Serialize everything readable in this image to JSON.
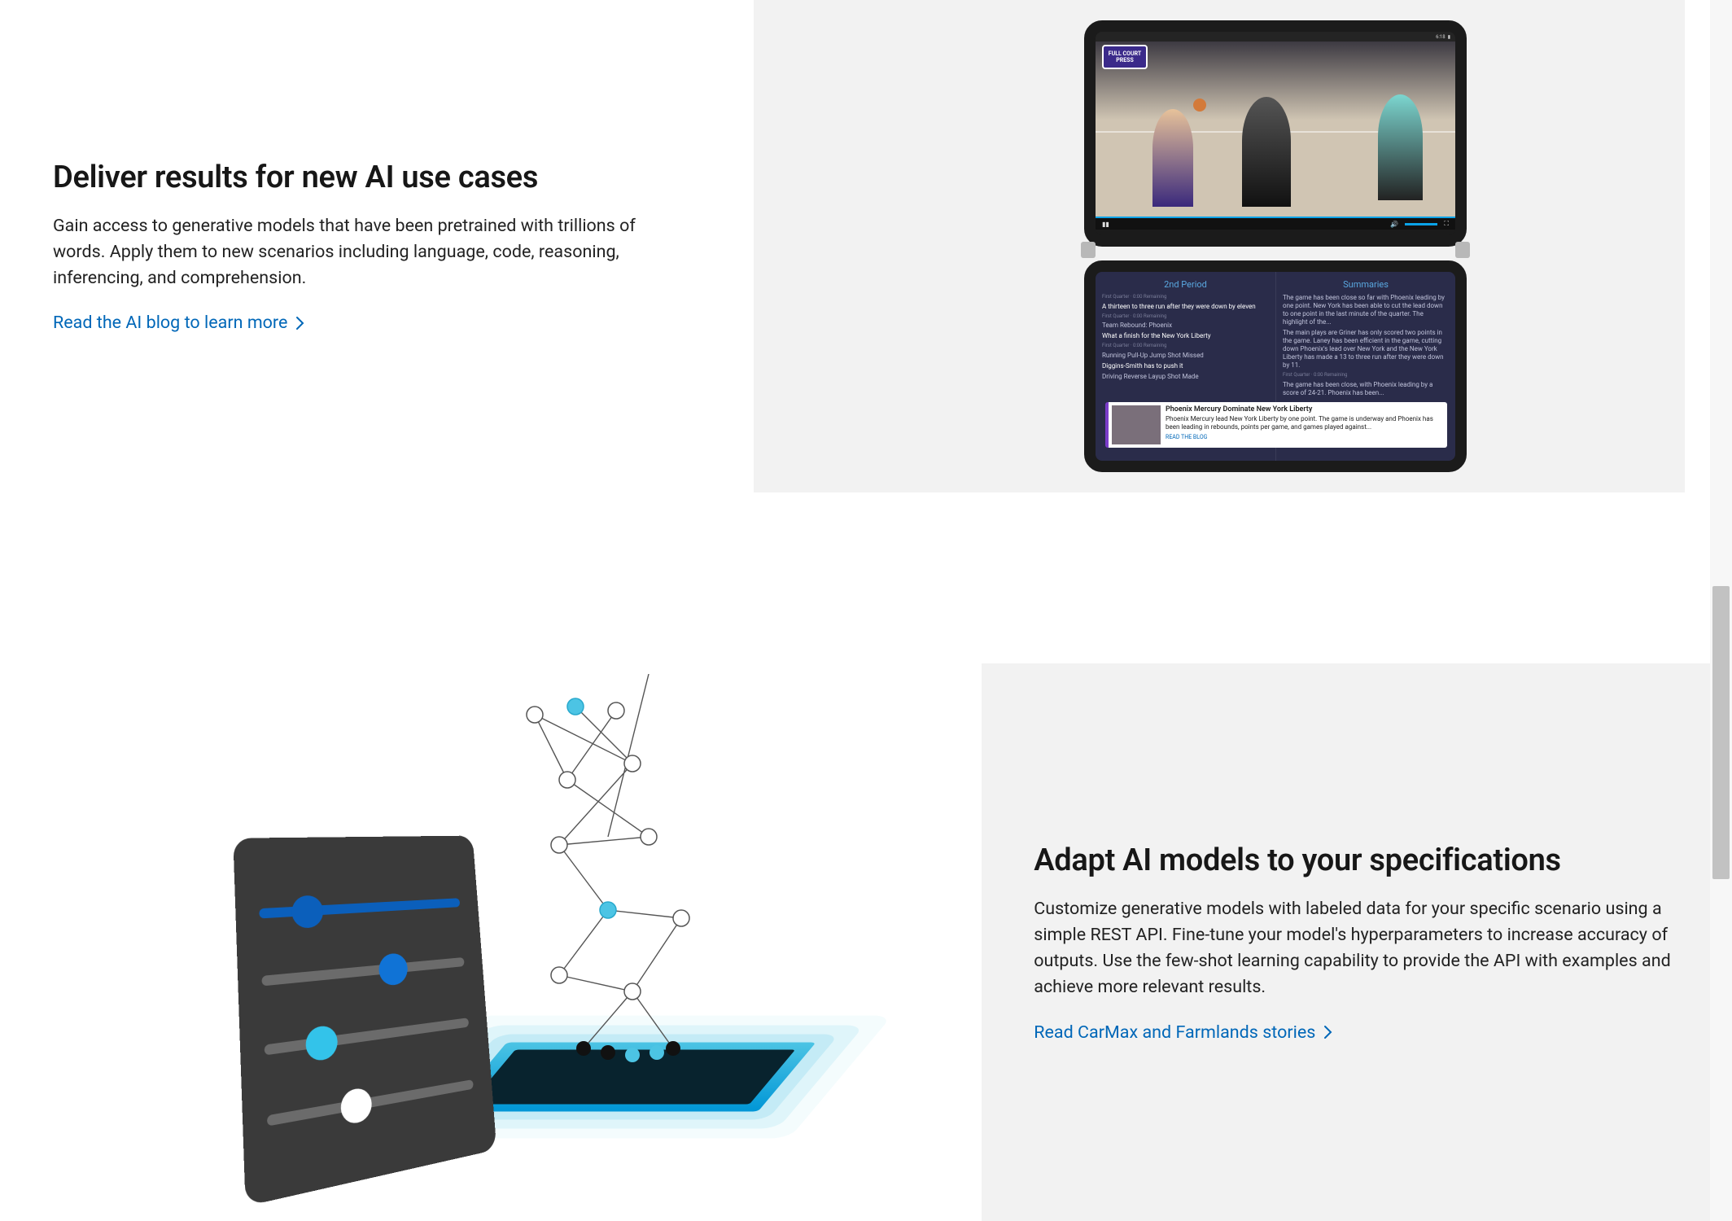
{
  "section1": {
    "heading": "Deliver results for new AI use cases",
    "body": "Gain access to generative models that have been pretrained with trillions of words. Apply them to new scenarios including language, code, reasoning, inferencing, and comprehension.",
    "link_label": "Read the AI blog to learn more"
  },
  "section2": {
    "heading": "Adapt AI models to your specifications",
    "body": "Customize generative models with labeled data for your specific scenario using a simple REST API. Fine-tune your model's hyperparameters to increase accuracy of outputs. Use the few-shot learning capability to provide the API with examples and achieve more relevant results.",
    "link_label": "Read CarMax and Farmlands stories"
  },
  "device": {
    "status_time": "6:18",
    "logo_text": "FULL COURT PRESS",
    "left_heading": "2nd Period",
    "left_sub": "First Quarter · 0:00 Remaining",
    "left_lines": [
      "A thirteen to three run after they were down by eleven",
      "Team Rebound: Phoenix",
      "What a finish for the New York Liberty",
      "Running Pull-Up Jump Shot Missed",
      "Diggins-Smith has to push it",
      "Driving Reverse Layup Shot Made"
    ],
    "right_heading": "Summaries",
    "right_lines": [
      "The game has been close so far with Phoenix leading by one point. New York has been able to cut the lead down to one point in the last minute of the quarter. The highlight of the...",
      "The main plays are Griner has only scored two points in the game. Laney has been efficient in the game, cutting down Phoenix's lead over New York and the New York Liberty has made a 13 to three run after they were down by 11.",
      "The game has been close, with Phoenix leading by a score of 24-21. Phoenix has been..."
    ],
    "card_title": "Phoenix Mercury Dominate New York Liberty",
    "card_body": "Phoenix Mercury lead New York Liberty by one point. The game is underway and Phoenix has been leading in rebounds, points per game, and games played against...",
    "card_cta": "READ THE BLOG"
  }
}
